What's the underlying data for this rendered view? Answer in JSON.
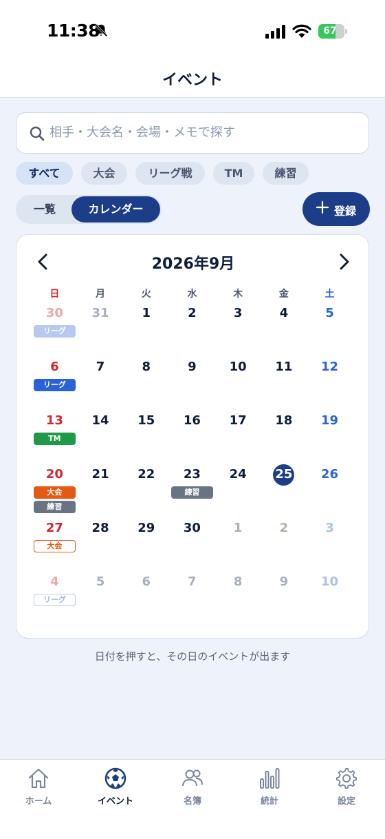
{
  "status_bar": {
    "time": "11:38",
    "battery": "67",
    "battery_level": 0.67
  },
  "header": {
    "title": "イベント"
  },
  "search": {
    "placeholder": "相手・大会名・会場・メモで探す",
    "value": ""
  },
  "filters": [
    {
      "label": "すべて",
      "active": true
    },
    {
      "label": "大会",
      "active": false
    },
    {
      "label": "リーグ戦",
      "active": false
    },
    {
      "label": "TM",
      "active": false
    },
    {
      "label": "練習",
      "active": false
    }
  ],
  "view_toggle": {
    "list": "一覧",
    "calendar": "カレンダー",
    "selected": "calendar"
  },
  "add_button": {
    "label": "登録"
  },
  "calendar": {
    "title": "2026年9月",
    "weekdays": [
      "日",
      "月",
      "火",
      "水",
      "木",
      "金",
      "土"
    ],
    "weeks": [
      [
        {
          "day": "30",
          "outside": true,
          "tags": [
            {
              "label": "リーグ",
              "style": "league-faded"
            }
          ]
        },
        {
          "day": "31",
          "outside": true,
          "tags": []
        },
        {
          "day": "1",
          "outside": false,
          "tags": []
        },
        {
          "day": "2",
          "outside": false,
          "tags": []
        },
        {
          "day": "3",
          "outside": false,
          "tags": []
        },
        {
          "day": "4",
          "outside": false,
          "tags": []
        },
        {
          "day": "5",
          "outside": false,
          "tags": []
        }
      ],
      [
        {
          "day": "6",
          "outside": false,
          "tags": [
            {
              "label": "リーグ",
              "style": "league"
            }
          ]
        },
        {
          "day": "7",
          "outside": false,
          "tags": []
        },
        {
          "day": "8",
          "outside": false,
          "tags": []
        },
        {
          "day": "9",
          "outside": false,
          "tags": []
        },
        {
          "day": "10",
          "outside": false,
          "tags": []
        },
        {
          "day": "11",
          "outside": false,
          "tags": []
        },
        {
          "day": "12",
          "outside": false,
          "tags": []
        }
      ],
      [
        {
          "day": "13",
          "outside": false,
          "tags": [
            {
              "label": "TM",
              "style": "tm"
            }
          ]
        },
        {
          "day": "14",
          "outside": false,
          "tags": []
        },
        {
          "day": "15",
          "outside": false,
          "tags": []
        },
        {
          "day": "16",
          "outside": false,
          "tags": []
        },
        {
          "day": "17",
          "outside": false,
          "tags": []
        },
        {
          "day": "18",
          "outside": false,
          "tags": []
        },
        {
          "day": "19",
          "outside": false,
          "tags": []
        }
      ],
      [
        {
          "day": "20",
          "outside": false,
          "tags": [
            {
              "label": "大会",
              "style": "taikai"
            },
            {
              "label": "練習",
              "style": "renshu"
            }
          ]
        },
        {
          "day": "21",
          "outside": false,
          "tags": []
        },
        {
          "day": "22",
          "outside": false,
          "tags": []
        },
        {
          "day": "23",
          "outside": false,
          "tags": [
            {
              "label": "練習",
              "style": "renshu"
            }
          ]
        },
        {
          "day": "24",
          "outside": false,
          "tags": []
        },
        {
          "day": "25",
          "outside": false,
          "today": true,
          "tags": []
        },
        {
          "day": "26",
          "outside": false,
          "tags": []
        }
      ],
      [
        {
          "day": "27",
          "outside": false,
          "tags": [
            {
              "label": "大会",
              "style": "taikai-outline"
            }
          ]
        },
        {
          "day": "28",
          "outside": false,
          "tags": []
        },
        {
          "day": "29",
          "outside": false,
          "tags": []
        },
        {
          "day": "30",
          "outside": false,
          "tags": []
        },
        {
          "day": "1",
          "outside": true,
          "tags": []
        },
        {
          "day": "2",
          "outside": true,
          "tags": []
        },
        {
          "day": "3",
          "outside": true,
          "tags": []
        }
      ],
      [
        {
          "day": "4",
          "outside": true,
          "tags": [
            {
              "label": "リーグ",
              "style": "league-outline"
            }
          ]
        },
        {
          "day": "5",
          "outside": true,
          "tags": []
        },
        {
          "day": "6",
          "outside": true,
          "tags": []
        },
        {
          "day": "7",
          "outside": true,
          "tags": []
        },
        {
          "day": "8",
          "outside": true,
          "tags": []
        },
        {
          "day": "9",
          "outside": true,
          "tags": []
        },
        {
          "day": "10",
          "outside": true,
          "tags": []
        }
      ]
    ]
  },
  "hint": "日付を押すと、その日のイベントが出ます",
  "tabbar": [
    {
      "label": "ホーム",
      "icon": "home-icon",
      "active": false
    },
    {
      "label": "イベント",
      "icon": "soccer-ball-icon",
      "active": true
    },
    {
      "label": "名簿",
      "icon": "people-icon",
      "active": false
    },
    {
      "label": "統計",
      "icon": "bar-chart-icon",
      "active": false
    },
    {
      "label": "設定",
      "icon": "gear-icon",
      "active": false
    }
  ],
  "colors": {
    "primary": "#1c3d87",
    "sunday": "#d6262f",
    "saturday": "#2a62d9",
    "league": "#2a62d9",
    "tm": "#1f9a47",
    "taikai": "#e55a12",
    "renshu": "#6a7384"
  }
}
